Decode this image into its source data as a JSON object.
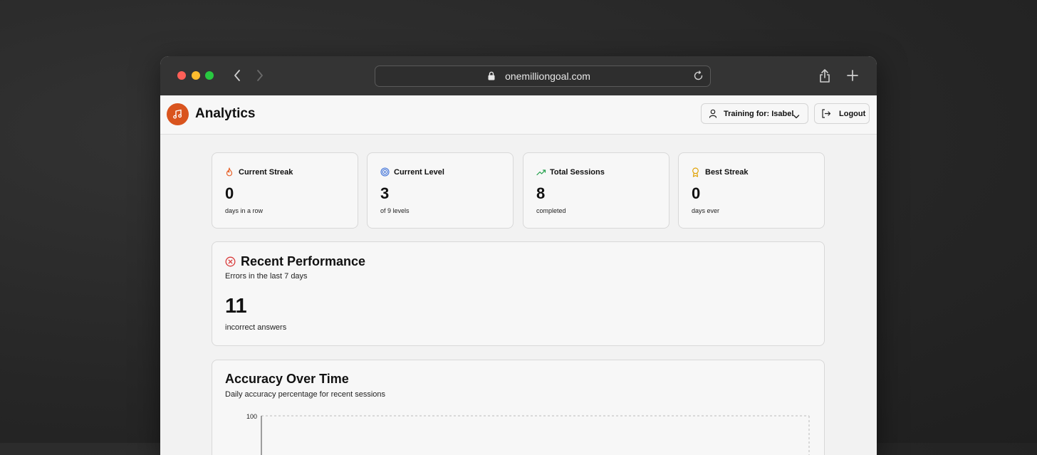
{
  "browser": {
    "url": "onemilliongoal.com",
    "icons": [
      "chevron-left-icon",
      "chevron-right-icon",
      "lock-icon",
      "reload-icon",
      "share-icon",
      "plus-icon"
    ]
  },
  "header": {
    "title": "Analytics",
    "training_label": "Training for: Isabel",
    "logout_label": "Logout",
    "brand_color": "#d9541e"
  },
  "stats": [
    {
      "title": "Current Streak",
      "value": "0",
      "sub": "days in a row",
      "icon": "flame-icon",
      "color": "#e8622a"
    },
    {
      "title": "Current Level",
      "value": "3",
      "sub": "of 9 levels",
      "icon": "target-icon",
      "color": "#3b6fd8"
    },
    {
      "title": "Total Sessions",
      "value": "8",
      "sub": "completed",
      "icon": "trending-up-icon",
      "color": "#22a04b"
    },
    {
      "title": "Best Streak",
      "value": "0",
      "sub": "days ever",
      "icon": "award-icon",
      "color": "#e0a100"
    }
  ],
  "performance": {
    "title": "Recent Performance",
    "desc": "Errors in the last 7 days",
    "value": "11",
    "sub": "incorrect answers",
    "icon": "x-circle-icon",
    "color": "#d93a3a"
  },
  "accuracy": {
    "title": "Accuracy Over Time",
    "desc": "Daily accuracy percentage for recent sessions"
  },
  "chart_data": {
    "type": "line",
    "title": "Accuracy Over Time",
    "y_ticks": [
      "100"
    ],
    "ylim": [
      0,
      100
    ],
    "grid": true,
    "series": []
  }
}
